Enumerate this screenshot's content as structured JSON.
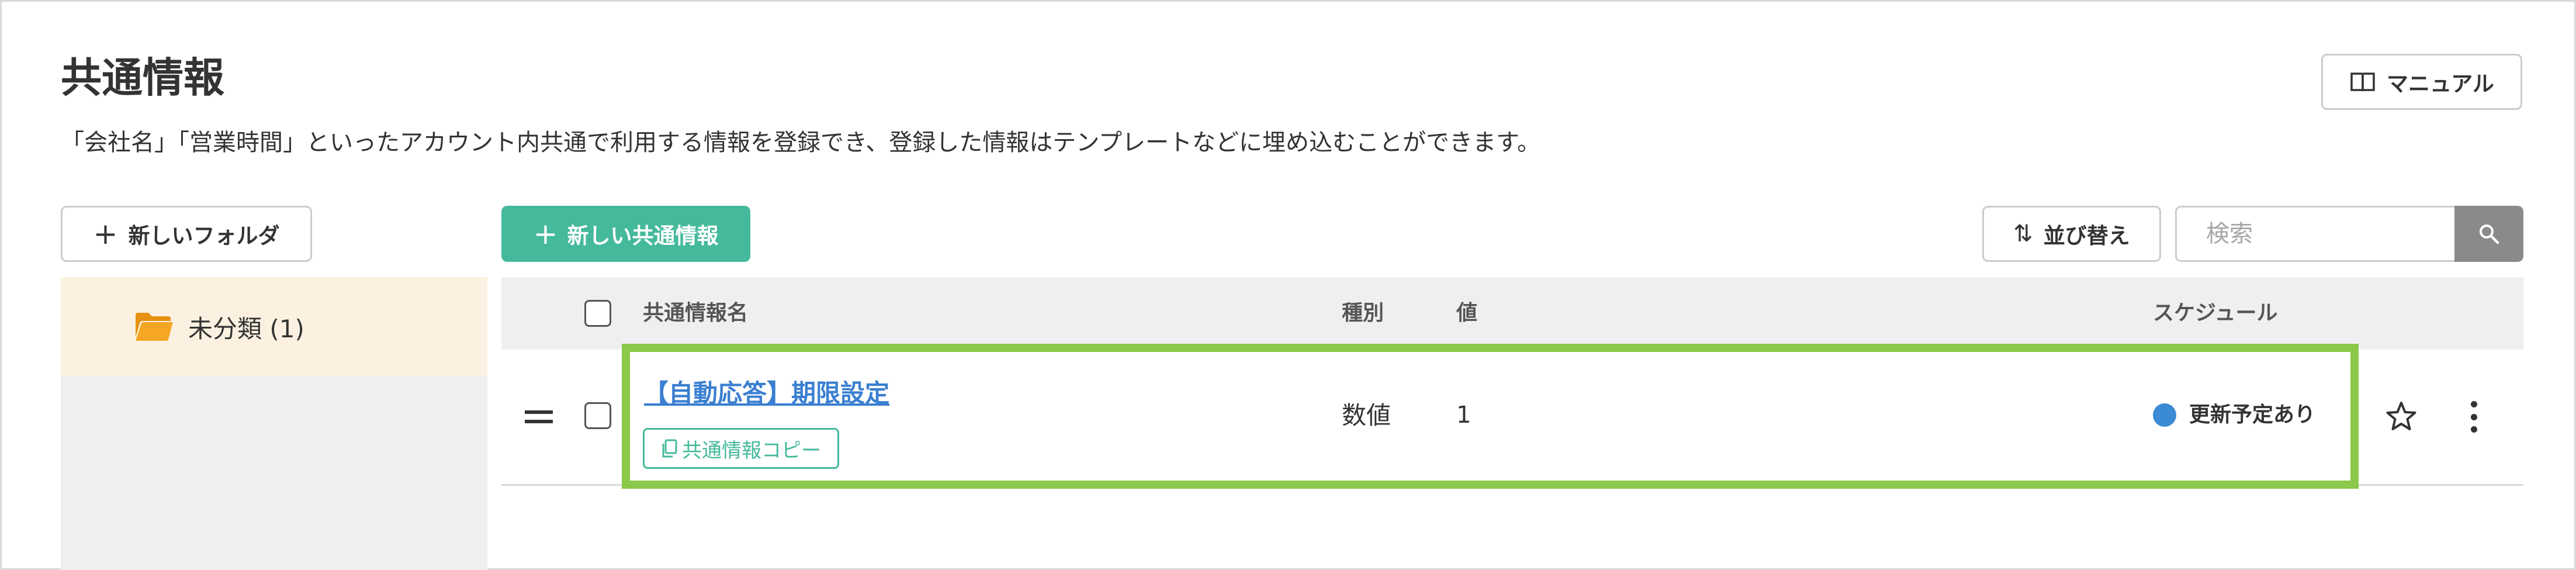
{
  "page": {
    "title": "共通情報",
    "description": "「会社名」「営業時間」といったアカウント内共通で利用する情報を登録でき、登録した情報はテンプレートなどに埋め込むことができます。"
  },
  "toolbar": {
    "manual_label": "マニュアル",
    "new_folder_label": "新しいフォルダ",
    "new_item_label": "新しい共通情報",
    "sort_label": "並び替え",
    "search_placeholder": "検索"
  },
  "sidebar": {
    "folders": [
      {
        "label": "未分類 (1)",
        "selected": true
      }
    ]
  },
  "table": {
    "columns": {
      "name": "共通情報名",
      "type": "種別",
      "value": "値",
      "schedule": "スケジュール"
    },
    "rows": [
      {
        "name": "【自動応答】期限設定",
        "copy_label": "共通情報コピー",
        "type": "数値",
        "value": "1",
        "schedule": "更新予定あり",
        "schedule_color": "#3a8ad5",
        "starred": false
      }
    ]
  },
  "colors": {
    "accent": "#45b99c",
    "link": "#3a7fd0",
    "highlight": "#8ac94a",
    "folder_icon": "#f0a020"
  }
}
